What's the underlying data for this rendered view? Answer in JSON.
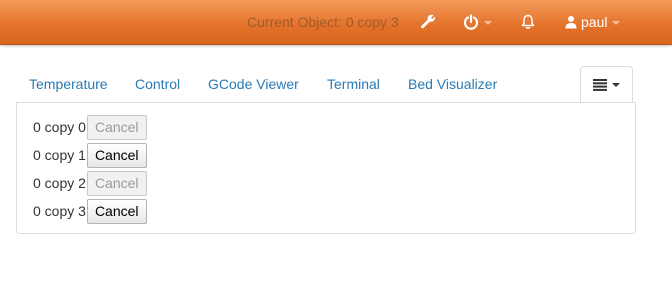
{
  "navbar": {
    "current_object": "Current Object: 0 copy 3",
    "user_name": "paul",
    "icons": [
      "wrench-icon",
      "power-icon",
      "bell-icon",
      "user-icon"
    ]
  },
  "tabs": [
    {
      "label": "Temperature"
    },
    {
      "label": "Control"
    },
    {
      "label": "GCode Viewer"
    },
    {
      "label": "Terminal"
    },
    {
      "label": "Bed Visualizer"
    }
  ],
  "tab_menu_icon": "list-icon",
  "objects": [
    {
      "label": "0 copy 0",
      "button": "Cancel",
      "enabled": false
    },
    {
      "label": "0 copy 1",
      "button": "Cancel",
      "enabled": true
    },
    {
      "label": "0 copy 2",
      "button": "Cancel",
      "enabled": false
    },
    {
      "label": "0 copy 3",
      "button": "Cancel",
      "enabled": true
    }
  ],
  "colors": {
    "navbar": "#e3712a",
    "tab_link": "#2a7bb4"
  }
}
